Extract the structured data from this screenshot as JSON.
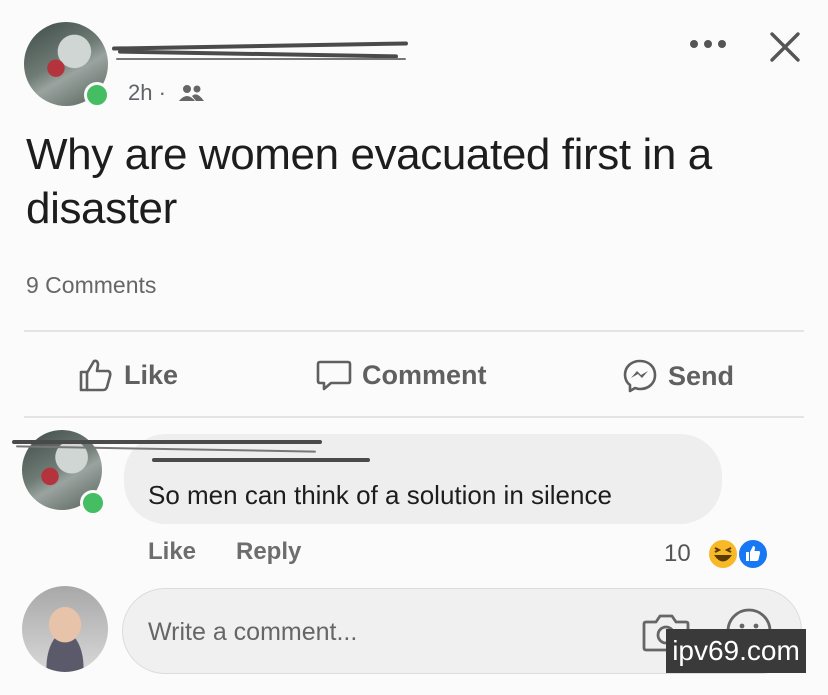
{
  "post": {
    "time": "2h",
    "separator": "·",
    "text": "Why are women evacuated first in a disaster",
    "comments_count": "9 Comments"
  },
  "actions": {
    "like": "Like",
    "comment": "Comment",
    "send": "Send"
  },
  "comment": {
    "text": "So men can think of a solution in silence",
    "like": "Like",
    "reply": "Reply",
    "reaction_count": "10",
    "reactions": [
      "haha-icon",
      "like-icon"
    ]
  },
  "composer": {
    "placeholder": "Write a comment..."
  },
  "watermark": "ipv69.com",
  "colors": {
    "online": "#45bd62",
    "like_reaction": "#1877f2",
    "haha_reaction": "#f7b928",
    "muted_text": "#606060"
  }
}
